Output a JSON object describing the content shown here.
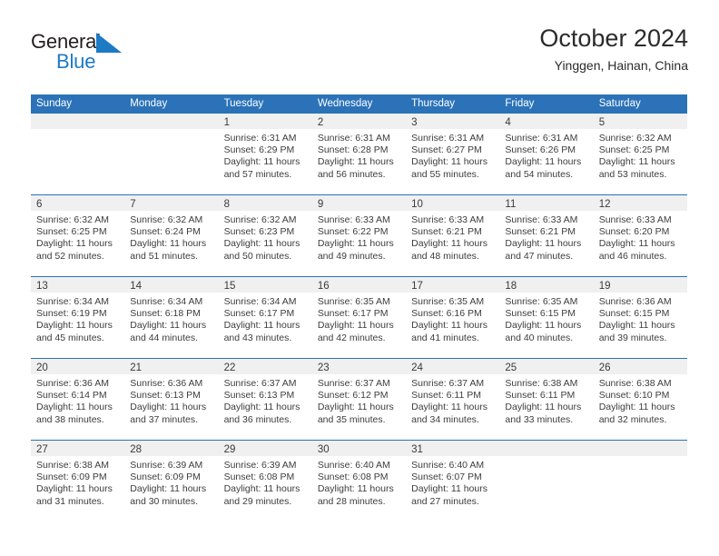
{
  "brand": {
    "name_top": "General",
    "name_bottom": "Blue",
    "triangle_color": "#1d7ac4"
  },
  "header": {
    "title": "October 2024",
    "subtitle": "Yinggen, Hainan, China"
  },
  "theme": {
    "header_blue": "#2b72b8",
    "day_band_gray": "#f0f0f0",
    "text_color": "#3d3d3d",
    "brand_blue": "#1d7ac4"
  },
  "weekday_headers": [
    "Sunday",
    "Monday",
    "Tuesday",
    "Wednesday",
    "Thursday",
    "Friday",
    "Saturday"
  ],
  "weeks": [
    [
      {
        "day": "",
        "sunrise": "",
        "sunset": "",
        "daylight": "",
        "empty": true
      },
      {
        "day": "",
        "sunrise": "",
        "sunset": "",
        "daylight": "",
        "empty": true
      },
      {
        "day": "1",
        "sunrise": "Sunrise: 6:31 AM",
        "sunset": "Sunset: 6:29 PM",
        "daylight": "Daylight: 11 hours and 57 minutes."
      },
      {
        "day": "2",
        "sunrise": "Sunrise: 6:31 AM",
        "sunset": "Sunset: 6:28 PM",
        "daylight": "Daylight: 11 hours and 56 minutes."
      },
      {
        "day": "3",
        "sunrise": "Sunrise: 6:31 AM",
        "sunset": "Sunset: 6:27 PM",
        "daylight": "Daylight: 11 hours and 55 minutes."
      },
      {
        "day": "4",
        "sunrise": "Sunrise: 6:31 AM",
        "sunset": "Sunset: 6:26 PM",
        "daylight": "Daylight: 11 hours and 54 minutes."
      },
      {
        "day": "5",
        "sunrise": "Sunrise: 6:32 AM",
        "sunset": "Sunset: 6:25 PM",
        "daylight": "Daylight: 11 hours and 53 minutes."
      }
    ],
    [
      {
        "day": "6",
        "sunrise": "Sunrise: 6:32 AM",
        "sunset": "Sunset: 6:25 PM",
        "daylight": "Daylight: 11 hours and 52 minutes."
      },
      {
        "day": "7",
        "sunrise": "Sunrise: 6:32 AM",
        "sunset": "Sunset: 6:24 PM",
        "daylight": "Daylight: 11 hours and 51 minutes."
      },
      {
        "day": "8",
        "sunrise": "Sunrise: 6:32 AM",
        "sunset": "Sunset: 6:23 PM",
        "daylight": "Daylight: 11 hours and 50 minutes."
      },
      {
        "day": "9",
        "sunrise": "Sunrise: 6:33 AM",
        "sunset": "Sunset: 6:22 PM",
        "daylight": "Daylight: 11 hours and 49 minutes."
      },
      {
        "day": "10",
        "sunrise": "Sunrise: 6:33 AM",
        "sunset": "Sunset: 6:21 PM",
        "daylight": "Daylight: 11 hours and 48 minutes."
      },
      {
        "day": "11",
        "sunrise": "Sunrise: 6:33 AM",
        "sunset": "Sunset: 6:21 PM",
        "daylight": "Daylight: 11 hours and 47 minutes."
      },
      {
        "day": "12",
        "sunrise": "Sunrise: 6:33 AM",
        "sunset": "Sunset: 6:20 PM",
        "daylight": "Daylight: 11 hours and 46 minutes."
      }
    ],
    [
      {
        "day": "13",
        "sunrise": "Sunrise: 6:34 AM",
        "sunset": "Sunset: 6:19 PM",
        "daylight": "Daylight: 11 hours and 45 minutes."
      },
      {
        "day": "14",
        "sunrise": "Sunrise: 6:34 AM",
        "sunset": "Sunset: 6:18 PM",
        "daylight": "Daylight: 11 hours and 44 minutes."
      },
      {
        "day": "15",
        "sunrise": "Sunrise: 6:34 AM",
        "sunset": "Sunset: 6:17 PM",
        "daylight": "Daylight: 11 hours and 43 minutes."
      },
      {
        "day": "16",
        "sunrise": "Sunrise: 6:35 AM",
        "sunset": "Sunset: 6:17 PM",
        "daylight": "Daylight: 11 hours and 42 minutes."
      },
      {
        "day": "17",
        "sunrise": "Sunrise: 6:35 AM",
        "sunset": "Sunset: 6:16 PM",
        "daylight": "Daylight: 11 hours and 41 minutes."
      },
      {
        "day": "18",
        "sunrise": "Sunrise: 6:35 AM",
        "sunset": "Sunset: 6:15 PM",
        "daylight": "Daylight: 11 hours and 40 minutes."
      },
      {
        "day": "19",
        "sunrise": "Sunrise: 6:36 AM",
        "sunset": "Sunset: 6:15 PM",
        "daylight": "Daylight: 11 hours and 39 minutes."
      }
    ],
    [
      {
        "day": "20",
        "sunrise": "Sunrise: 6:36 AM",
        "sunset": "Sunset: 6:14 PM",
        "daylight": "Daylight: 11 hours and 38 minutes."
      },
      {
        "day": "21",
        "sunrise": "Sunrise: 6:36 AM",
        "sunset": "Sunset: 6:13 PM",
        "daylight": "Daylight: 11 hours and 37 minutes."
      },
      {
        "day": "22",
        "sunrise": "Sunrise: 6:37 AM",
        "sunset": "Sunset: 6:13 PM",
        "daylight": "Daylight: 11 hours and 36 minutes."
      },
      {
        "day": "23",
        "sunrise": "Sunrise: 6:37 AM",
        "sunset": "Sunset: 6:12 PM",
        "daylight": "Daylight: 11 hours and 35 minutes."
      },
      {
        "day": "24",
        "sunrise": "Sunrise: 6:37 AM",
        "sunset": "Sunset: 6:11 PM",
        "daylight": "Daylight: 11 hours and 34 minutes."
      },
      {
        "day": "25",
        "sunrise": "Sunrise: 6:38 AM",
        "sunset": "Sunset: 6:11 PM",
        "daylight": "Daylight: 11 hours and 33 minutes."
      },
      {
        "day": "26",
        "sunrise": "Sunrise: 6:38 AM",
        "sunset": "Sunset: 6:10 PM",
        "daylight": "Daylight: 11 hours and 32 minutes."
      }
    ],
    [
      {
        "day": "27",
        "sunrise": "Sunrise: 6:38 AM",
        "sunset": "Sunset: 6:09 PM",
        "daylight": "Daylight: 11 hours and 31 minutes."
      },
      {
        "day": "28",
        "sunrise": "Sunrise: 6:39 AM",
        "sunset": "Sunset: 6:09 PM",
        "daylight": "Daylight: 11 hours and 30 minutes."
      },
      {
        "day": "29",
        "sunrise": "Sunrise: 6:39 AM",
        "sunset": "Sunset: 6:08 PM",
        "daylight": "Daylight: 11 hours and 29 minutes."
      },
      {
        "day": "30",
        "sunrise": "Sunrise: 6:40 AM",
        "sunset": "Sunset: 6:08 PM",
        "daylight": "Daylight: 11 hours and 28 minutes."
      },
      {
        "day": "31",
        "sunrise": "Sunrise: 6:40 AM",
        "sunset": "Sunset: 6:07 PM",
        "daylight": "Daylight: 11 hours and 27 minutes."
      },
      {
        "day": "",
        "sunrise": "",
        "sunset": "",
        "daylight": "",
        "empty": true
      },
      {
        "day": "",
        "sunrise": "",
        "sunset": "",
        "daylight": "",
        "empty": true
      }
    ]
  ]
}
